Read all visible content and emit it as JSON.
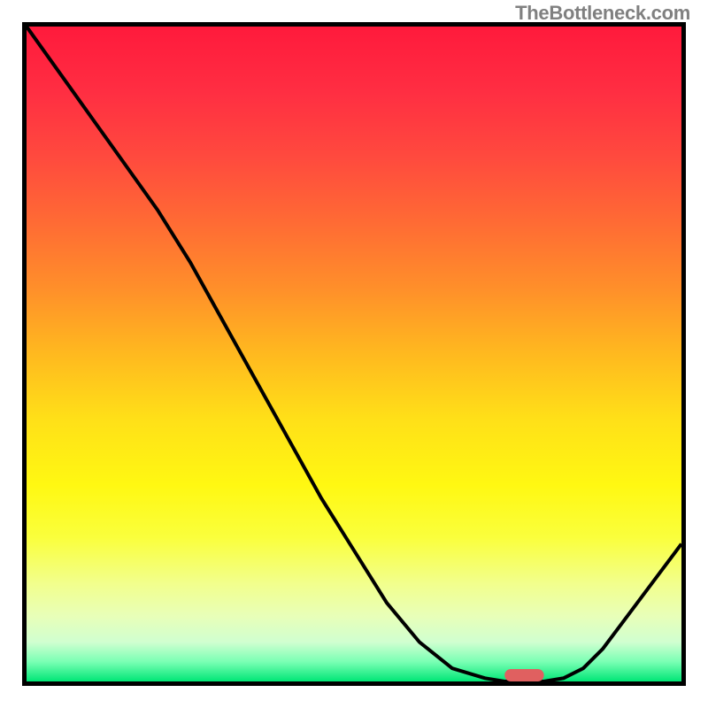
{
  "watermark": "TheBottleneck.com",
  "chart_data": {
    "type": "line",
    "title": "",
    "xlabel": "",
    "ylabel": "",
    "x": [
      0.0,
      0.05,
      0.1,
      0.15,
      0.2,
      0.25,
      0.3,
      0.35,
      0.4,
      0.45,
      0.5,
      0.55,
      0.6,
      0.65,
      0.7,
      0.73,
      0.76,
      0.79,
      0.82,
      0.85,
      0.88,
      0.91,
      0.94,
      0.97,
      1.0
    ],
    "values": [
      1.0,
      0.93,
      0.86,
      0.79,
      0.72,
      0.64,
      0.55,
      0.46,
      0.37,
      0.28,
      0.2,
      0.12,
      0.06,
      0.02,
      0.005,
      0.0,
      0.0,
      0.0,
      0.005,
      0.02,
      0.05,
      0.09,
      0.13,
      0.17,
      0.21
    ],
    "xlim": [
      0,
      1
    ],
    "ylim": [
      0,
      1
    ],
    "flat_segment_x": [
      0.73,
      0.79
    ],
    "marker_x": 0.76,
    "marker_y": 0.0,
    "gradient_stops": [
      {
        "offset": 0.0,
        "color": "#ff1a3c"
      },
      {
        "offset": 0.1,
        "color": "#ff2e42"
      },
      {
        "offset": 0.2,
        "color": "#ff4a3e"
      },
      {
        "offset": 0.3,
        "color": "#ff6b34"
      },
      {
        "offset": 0.4,
        "color": "#ff8f2a"
      },
      {
        "offset": 0.5,
        "color": "#ffb91f"
      },
      {
        "offset": 0.6,
        "color": "#ffe018"
      },
      {
        "offset": 0.7,
        "color": "#fff812"
      },
      {
        "offset": 0.78,
        "color": "#faff3c"
      },
      {
        "offset": 0.85,
        "color": "#f2ff8c"
      },
      {
        "offset": 0.9,
        "color": "#e8ffb8"
      },
      {
        "offset": 0.94,
        "color": "#d0ffd0"
      },
      {
        "offset": 0.97,
        "color": "#7affb4"
      },
      {
        "offset": 1.0,
        "color": "#00e676"
      }
    ],
    "marker_color": "#e06060"
  }
}
